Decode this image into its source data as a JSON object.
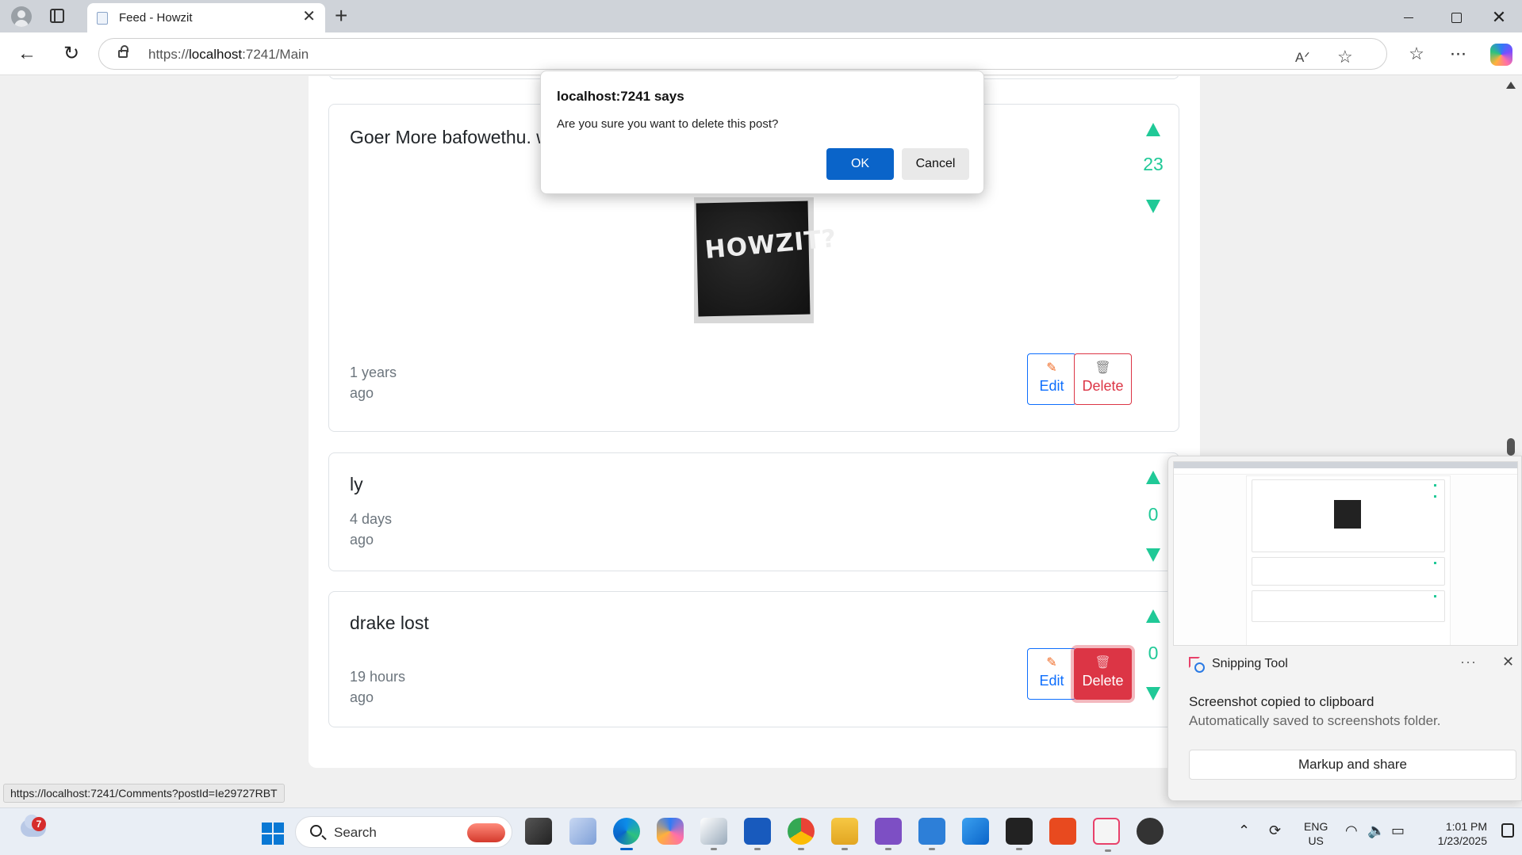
{
  "browser": {
    "tab_title": "Feed - Howzit",
    "url_prefix": "https://",
    "url_host": "localhost",
    "url_rest": ":7241/Main",
    "status_url": "https://localhost:7241/Comments?postId=Ie29727RBT"
  },
  "dialog": {
    "title": "localhost:7241 says",
    "message": "Are you sure you want to delete this post?",
    "ok_label": "OK",
    "cancel_label": "Cancel"
  },
  "posts": [
    {
      "text": "Goer More bafowethu. w",
      "votes": "23",
      "time": "1 years ago",
      "image_text": "HOWZIT?",
      "edit_label": "Edit",
      "delete_label": "Delete"
    },
    {
      "text": "ly",
      "votes": "0",
      "time": "4 days ago"
    },
    {
      "text": "drake lost",
      "votes": "0",
      "time": "19 hours ago",
      "edit_label": "Edit",
      "delete_label": "Delete"
    }
  ],
  "toast": {
    "app_name": "Snipping Tool",
    "heading": "Screenshot copied to clipboard",
    "subtext": "Automatically saved to screenshots folder.",
    "button_label": "Markup and share"
  },
  "taskbar": {
    "weather_badge": "7",
    "search_label": "Search",
    "lang_line1": "ENG",
    "lang_line2": "US",
    "time": "1:01 PM",
    "date": "1/23/2025"
  },
  "colors": {
    "vote": "#20c997",
    "edit": "#0d6efd",
    "delete": "#dc3545",
    "dialog_ok": "#0a64c9"
  }
}
